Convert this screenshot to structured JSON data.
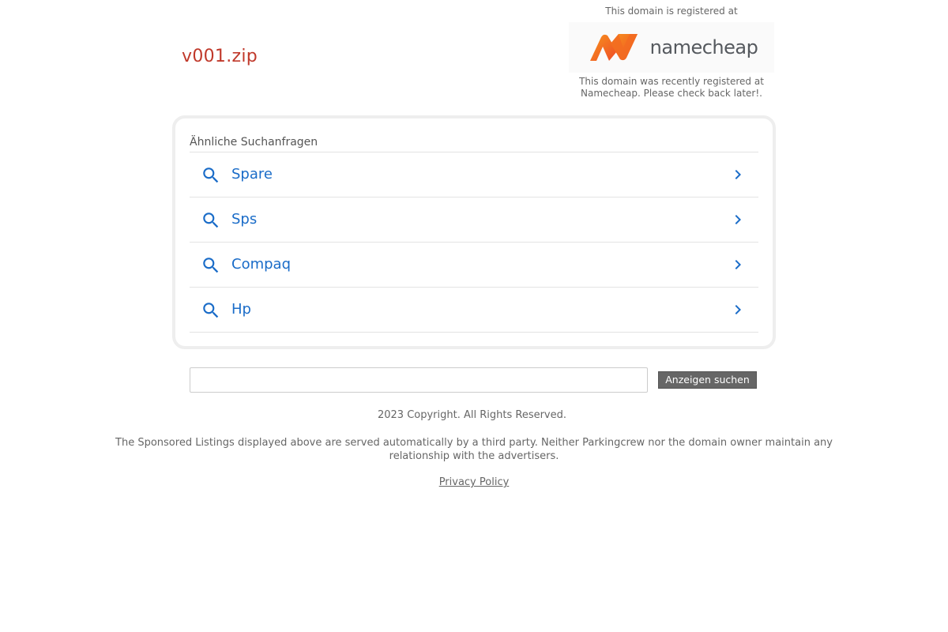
{
  "domain": {
    "name": "v001.zip"
  },
  "registrar": {
    "top_text": "This domain is registered at",
    "logo_text": "namecheap",
    "bottom_text": "This domain was recently registered at Namecheap. Please check back later!."
  },
  "related": {
    "heading": "Ähnliche Suchanfragen",
    "items": [
      {
        "label": "Spare",
        "icon": "search-icon",
        "chevron": "chevron-right-icon"
      },
      {
        "label": "Sps",
        "icon": "search-icon",
        "chevron": "chevron-right-icon"
      },
      {
        "label": "Compaq",
        "icon": "search-icon",
        "chevron": "chevron-right-icon"
      },
      {
        "label": "Hp",
        "icon": "search-icon",
        "chevron": "chevron-right-icon"
      }
    ]
  },
  "search": {
    "value": "",
    "button_label": "Anzeigen suchen"
  },
  "footer": {
    "copyright": "2023 Copyright. All Rights Reserved.",
    "disclaimer": "The Sponsored Listings displayed above are served automatically by a third party. Neither Parkingcrew nor the domain owner maintain any relationship with the advertisers.",
    "privacy_label": "Privacy Policy"
  },
  "colors": {
    "domain_title": "#c0392b",
    "link_blue": "#1a6cc8",
    "button_bg": "#666666",
    "logo_orange": "#f26b21"
  }
}
